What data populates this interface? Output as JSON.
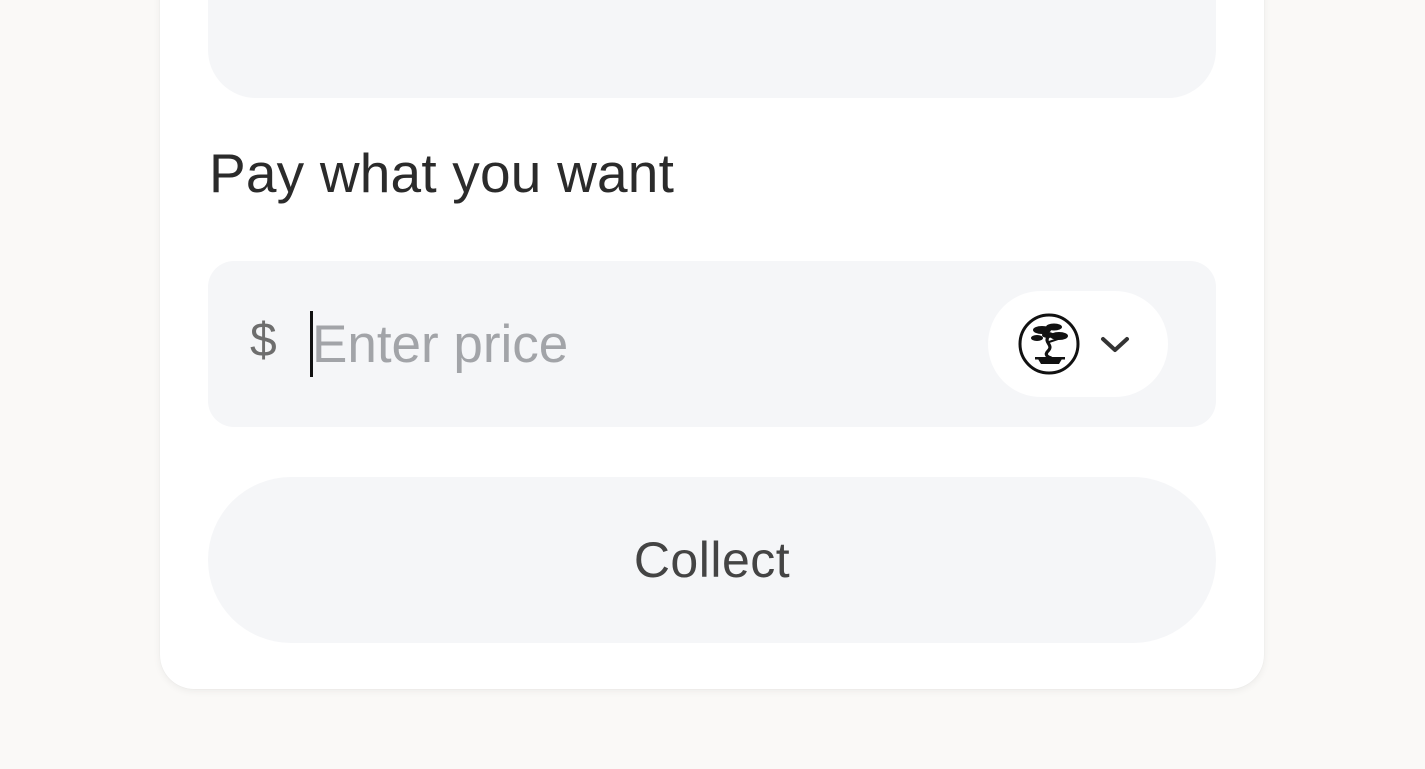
{
  "payment": {
    "section_label": "Pay what you want",
    "currency_symbol": "$",
    "price_placeholder": "Enter price",
    "price_value": "",
    "token_selector": {
      "icon": "bonsai-token-icon",
      "chevron_icon": "chevron-down-icon"
    },
    "collect_label": "Collect"
  },
  "colors": {
    "background": "#faf9f7",
    "card": "#ffffff",
    "field": "#f5f6f8",
    "text": "#2b2b2b",
    "placeholder": "#a2a4a8"
  }
}
